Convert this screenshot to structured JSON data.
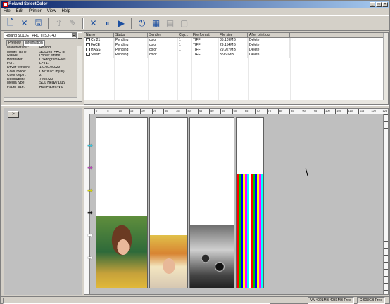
{
  "window": {
    "title": "Roland SelectColor",
    "controls": [
      "_",
      "□",
      "×"
    ]
  },
  "menu": [
    "File",
    "Edit",
    "Printer",
    "View",
    "Help"
  ],
  "toolbar": {
    "buttons": [
      {
        "name": "new-icon",
        "glyph": "🗋",
        "enabled": true
      },
      {
        "name": "delete-icon",
        "glyph": "✕",
        "enabled": true
      },
      {
        "name": "save-icon",
        "glyph": "🖫",
        "enabled": true
      },
      {
        "name": "move-up-icon",
        "glyph": "⇧",
        "enabled": false
      },
      {
        "name": "edit-icon",
        "glyph": "✎",
        "enabled": false
      },
      {
        "name": "cancel-icon",
        "glyph": "✕",
        "enabled": true
      },
      {
        "name": "pause-icon",
        "glyph": "⏸",
        "enabled": true
      },
      {
        "name": "play-icon",
        "glyph": "▶",
        "enabled": true
      },
      {
        "name": "stop-icon",
        "glyph": "⏻",
        "enabled": true
      },
      {
        "name": "layout-icon",
        "glyph": "▦",
        "enabled": true
      },
      {
        "name": "grid-icon",
        "glyph": "▤",
        "enabled": false
      },
      {
        "name": "page-icon",
        "glyph": "▢",
        "enabled": false
      }
    ]
  },
  "printer_select": "Roland SOLJET PRO III SJ-740",
  "tabs": [
    {
      "label": "Preview",
      "active": false
    },
    {
      "label": "Information",
      "active": true
    }
  ],
  "info": [
    {
      "k": "Manufacturer:",
      "v": "Roland"
    },
    {
      "k": "Model name:",
      "v": "SOLJET PRO III"
    },
    {
      "k": "Status:",
      "v": "Printer offline"
    },
    {
      "k": "Hot folder:",
      "v": "C:\\Program Files"
    },
    {
      "k": "Port:",
      "v": "LPT1:"
    },
    {
      "k": "Driver version:",
      "v": "1.0.00.00029"
    },
    {
      "k": "Color mode:",
      "v": "CMYKLcLm(Or)"
    },
    {
      "k": "Color depth:",
      "v": "2"
    },
    {
      "k": "Resolution:",
      "v": "720x720"
    },
    {
      "k": "Media type:",
      "v": "SOL Heavy Duty"
    },
    {
      "k": "Paper size:",
      "v": "Roll Paper(Wid"
    }
  ],
  "job_columns": [
    "Name",
    "Status",
    "Sender",
    "Cop...",
    "File format",
    "File size",
    "After print out"
  ],
  "jobs": [
    {
      "name": "Ctrl21",
      "status": "Pending",
      "sender": "color",
      "copies": "1",
      "format": "TIFF",
      "size": "35.109MB",
      "after": "Delete"
    },
    {
      "name": "FACE",
      "status": "Pending",
      "sender": "color",
      "copies": "1",
      "format": "TIFF",
      "size": "29.154MB",
      "after": "Delete"
    },
    {
      "name": "HASS",
      "status": "Pending",
      "sender": "color",
      "copies": "1",
      "format": "TIFF",
      "size": "29.927MB",
      "after": "Delete"
    },
    {
      "name": "Swatc",
      "status": "Pending",
      "sender": "color",
      "copies": "1",
      "format": "TIFF",
      "size": "3.960MB",
      "after": "Delete"
    }
  ],
  "ruler_labels": [
    "0",
    "5",
    "10",
    "15",
    "20",
    "25",
    "30",
    "35",
    "40",
    "45",
    "50",
    "55",
    "60",
    "65",
    "70",
    "75",
    "80",
    "85",
    "90",
    "95",
    "100",
    "105",
    "110",
    "115",
    "120",
    "125"
  ],
  "nav_arrows": [
    {
      "name": "arrow-cyan-icon",
      "color": "#34c6de"
    },
    {
      "name": "arrow-magenta-icon",
      "color": "#c040c0"
    },
    {
      "name": "arrow-yellow-icon",
      "color": "#d6d600"
    },
    {
      "name": "arrow-black-icon",
      "color": "#111111"
    },
    {
      "name": "arrow-white-icon",
      "color": "#ffffff"
    },
    {
      "name": "arrow-white-icon",
      "color": "#ffffff"
    }
  ],
  "status": {
    "memory": "VM4021MB 4036MB Free",
    "disk": "C:603GB Free"
  },
  "preview_button": ">"
}
